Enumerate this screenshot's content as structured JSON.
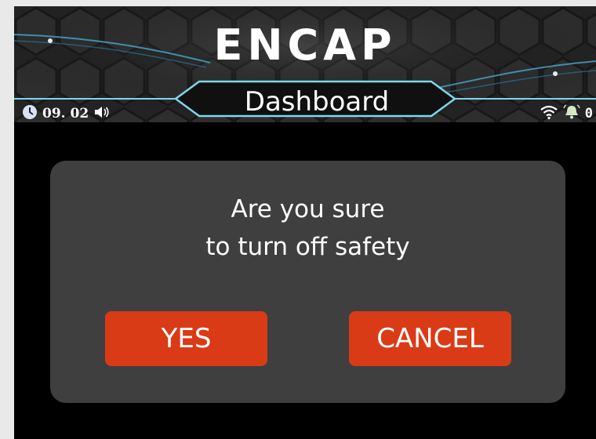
{
  "header": {
    "logo_text": "ENCAP",
    "title": "Dashboard",
    "date": "09. 02",
    "alarm_count": "0"
  },
  "dialog": {
    "message_line1": "Are you sure",
    "message_line2": "to turn off safety",
    "yes_label": "YES",
    "cancel_label": "CANCEL"
  },
  "colors": {
    "button": "#d93b17",
    "dialog_bg": "#3f3f3f",
    "accent_line": "#7fd7ea",
    "screen_bg": "#000000"
  },
  "icons": [
    "clock-icon",
    "speaker-icon",
    "wifi-icon",
    "bell-icon"
  ]
}
